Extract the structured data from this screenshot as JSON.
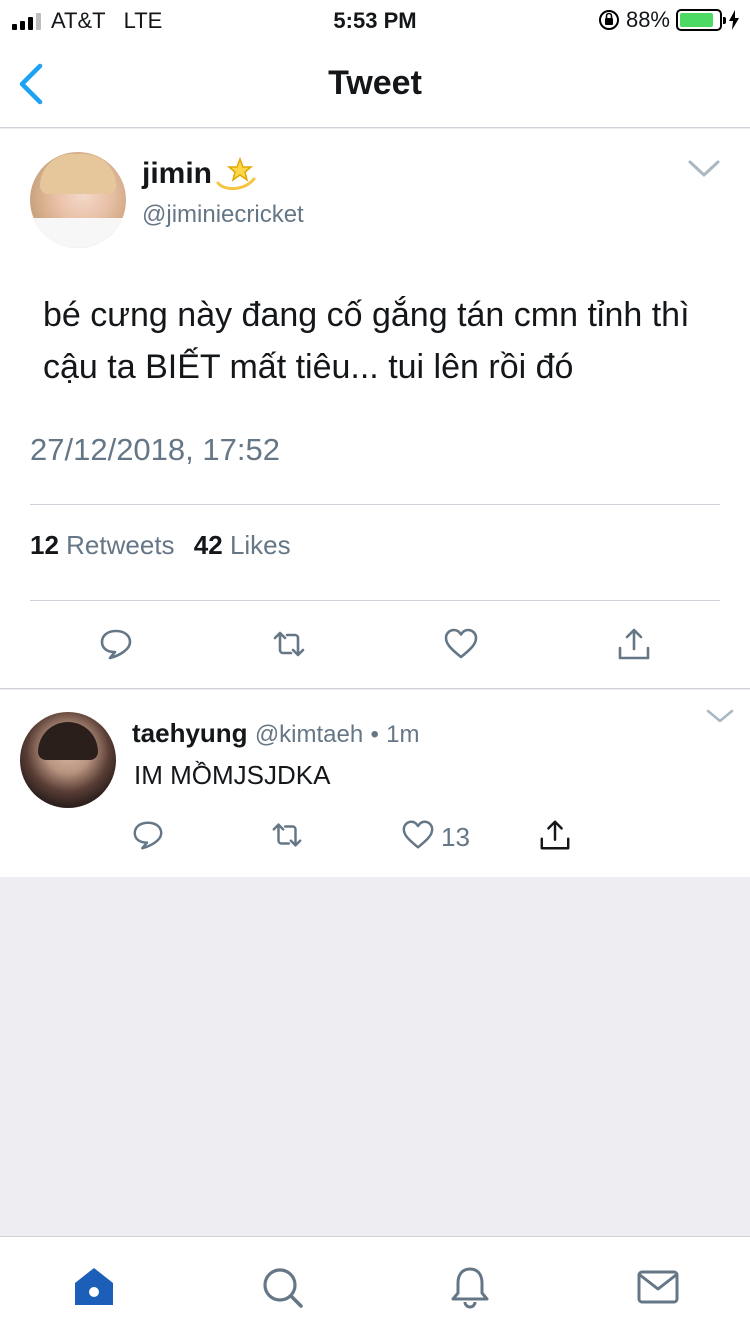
{
  "status_bar": {
    "carrier": "AT&T",
    "network": "LTE",
    "time": "5:53 PM",
    "battery_percent": "88%",
    "battery_level": 0.88
  },
  "nav": {
    "title": "Tweet",
    "back_icon": "chevron-left-icon"
  },
  "tweet": {
    "author_name": "jimin",
    "author_emoji_icon": "dizzy-star-icon",
    "author_handle": "@jiminiecricket",
    "text": "bé cưng này đang cố gắng tán cmn tỉnh thì cậu ta BIẾT mất tiêu... tui lên rồi đó",
    "timestamp": "27/12/2018, 17:52",
    "retweet_count": "12",
    "retweet_label": "Retweets",
    "like_count": "42",
    "like_label": "Likes",
    "actions": [
      "reply-icon",
      "retweet-icon",
      "like-icon",
      "share-icon"
    ]
  },
  "reply": {
    "author_name": "taehyung",
    "author_handle": "@kimtaeh",
    "separator": "•",
    "time_ago": "1m",
    "text": "IM MỒMJSJDKA",
    "like_count": "13"
  },
  "tab_bar": {
    "tabs": [
      "home-icon",
      "search-icon",
      "notifications-icon",
      "messages-icon"
    ],
    "active": "home-icon"
  },
  "colors": {
    "accent": "#1da1f2",
    "tab_active": "#1c5fb8",
    "secondary_text": "#657786",
    "icon_gray": "#657786",
    "battery_green": "#4cd964",
    "background": "#ededf2"
  }
}
